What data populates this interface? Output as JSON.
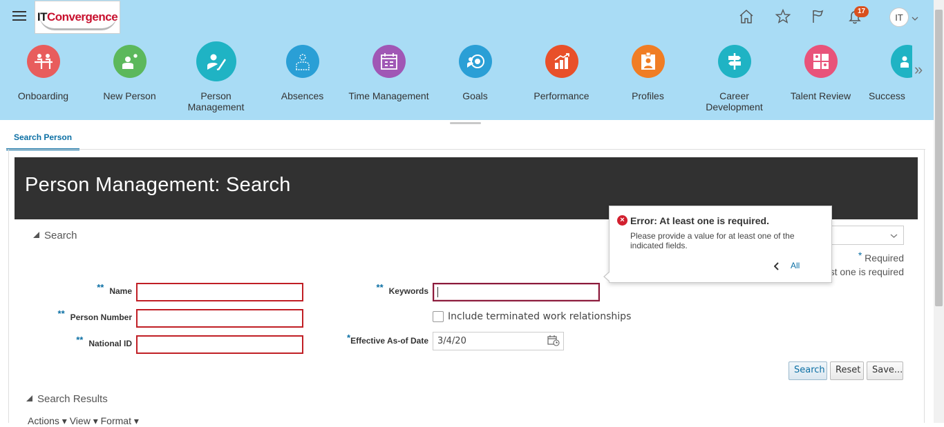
{
  "header": {
    "logo": {
      "prefix": "IT",
      "suffix": "Convergence"
    },
    "notification_count": "17",
    "user_initials": "IT"
  },
  "springboard": [
    {
      "label": "Onboarding",
      "color": "#e85d5d"
    },
    {
      "label": "New Person",
      "color": "#5cb85c"
    },
    {
      "label": "Person Management",
      "color": "#1fb3c4"
    },
    {
      "label": "Absences",
      "color": "#2a9fd6"
    },
    {
      "label": "Time Management",
      "color": "#a057b5"
    },
    {
      "label": "Goals",
      "color": "#2a9fd6"
    },
    {
      "label": "Performance",
      "color": "#e8502a"
    },
    {
      "label": "Profiles",
      "color": "#f07d24"
    },
    {
      "label": "Career Development",
      "color": "#1fb3c4"
    },
    {
      "label": "Talent Review",
      "color": "#e8537a"
    },
    {
      "label": "Success",
      "color": "#1fb3c4"
    }
  ],
  "tabs": [
    {
      "label": "Search Person"
    }
  ],
  "page": {
    "title": "Person Management: Search",
    "search_section": "Search",
    "results_section": "Search Results",
    "results_toolbar": "Actions ▾   View ▾   Format ▾"
  },
  "form": {
    "name_label": "Name",
    "person_number_label": "Person Number",
    "national_id_label": "National ID",
    "keywords_label": "Keywords",
    "include_terminated_label": "Include terminated work relationships",
    "effective_date_label": "Effective As-of Date",
    "effective_date_value": "3/4/20",
    "required_note": "Required",
    "at_least_one_note": "At least one is required",
    "search_button": "Search",
    "reset_button": "Reset",
    "save_button": "Save..."
  },
  "error_popup": {
    "title": "Error: At least one is required.",
    "message": "Please provide a value for at least one of the indicated fields.",
    "nav_label": "All"
  }
}
